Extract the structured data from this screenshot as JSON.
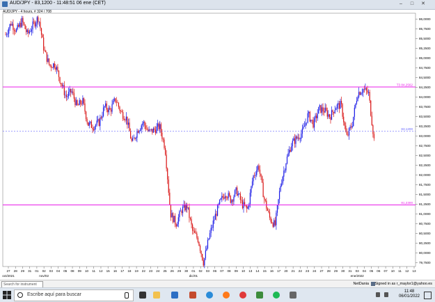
{
  "window": {
    "title": "AUD/JPY - 83,1200 - 11:48:51  06 ene (CET)",
    "chart_info": "AUD/JPY - 4 hours, # 324 / 708"
  },
  "colors": {
    "bull": "#1a1ae6",
    "bear": "#d91414",
    "hline": "#e81ce8",
    "bid_line": "#6666ff"
  },
  "chart_data": {
    "type": "candlestick",
    "title": "",
    "ylim": [
      79.65,
      86.15
    ],
    "y_ticks": [
      "86,0000",
      "85,7500",
      "85,5000",
      "85,2500",
      "85,0000",
      "84,7500",
      "84,5000",
      "84,2500",
      "84,0000",
      "83,7500",
      "83,5000",
      "83,2500",
      "83,0000",
      "82,7500",
      "82,5000",
      "82,2500",
      "82,0000",
      "81,7500",
      "81,5000",
      "81,2500",
      "81,0000",
      "80,7500",
      "80,5000",
      "80,2500",
      "80,0000",
      "79,7500"
    ],
    "x_ticks": [
      "27",
      "28",
      "29",
      "31",
      "01",
      "02",
      "03",
      "04",
      "05",
      "08",
      "09",
      "10",
      "11",
      "12",
      "15",
      "16",
      "17",
      "18",
      "19",
      "22",
      "23",
      "24",
      "25",
      "26",
      "29",
      "30",
      "01",
      "02",
      "03",
      "06",
      "07",
      "08",
      "09",
      "10",
      "13",
      "14",
      "15",
      "16",
      "17",
      "20",
      "21",
      "22",
      "23",
      "24",
      "27",
      "28",
      "29",
      "30",
      "31",
      "03",
      "04",
      "05",
      "06",
      "07",
      "10",
      "11",
      "12",
      "13"
    ],
    "x_sublabels": [
      {
        "tick": 0,
        "text": "oct/2021"
      },
      {
        "tick": 5,
        "text": "nov/02"
      },
      {
        "tick": 26,
        "text": "dic/01"
      },
      {
        "tick": 49,
        "text": "ene/2022"
      }
    ],
    "horizontal_lines": [
      {
        "name": "T3",
        "value": 84.2562,
        "label": "T3 84,2562",
        "style": "solid"
      },
      {
        "name": "bid",
        "value": 83.12,
        "label": "83,1200",
        "style": "dashed"
      },
      {
        "name": "support",
        "value": 81.23,
        "label": "81,2300",
        "style": "solid"
      }
    ],
    "path": [
      85.6,
      85.9,
      85.7,
      85.95,
      85.6,
      85.85,
      86.05,
      85.2,
      84.8,
      84.85,
      84.4,
      84.0,
      84.15,
      83.75,
      83.9,
      83.3,
      83.25,
      83.35,
      83.75,
      83.65,
      83.95,
      83.6,
      83.45,
      82.8,
      83.15,
      83.35,
      83.1,
      83.15,
      83.25,
      82.7,
      81.0,
      80.75,
      81.1,
      81.2,
      80.55,
      80.35,
      79.75,
      80.4,
      80.9,
      81.3,
      81.55,
      81.35,
      81.6,
      81.25,
      81.1,
      81.95,
      82.25,
      81.4,
      80.9,
      80.7,
      81.75,
      82.35,
      82.8,
      82.95,
      83.1,
      83.55,
      83.3,
      83.7,
      83.65,
      83.5,
      83.75,
      83.8,
      82.95,
      83.3,
      84.1,
      84.2,
      84.1,
      82.9
    ]
  },
  "status_bar": {
    "search_placeholder": "Search for instrument",
    "provider": "NetDania",
    "signed_in": "Signed in as r_maylor1@yahoo.es"
  },
  "taskbar": {
    "search_placeholder": "Escribe aquí para buscar",
    "time": "11:48",
    "date": "06/01/2022"
  }
}
